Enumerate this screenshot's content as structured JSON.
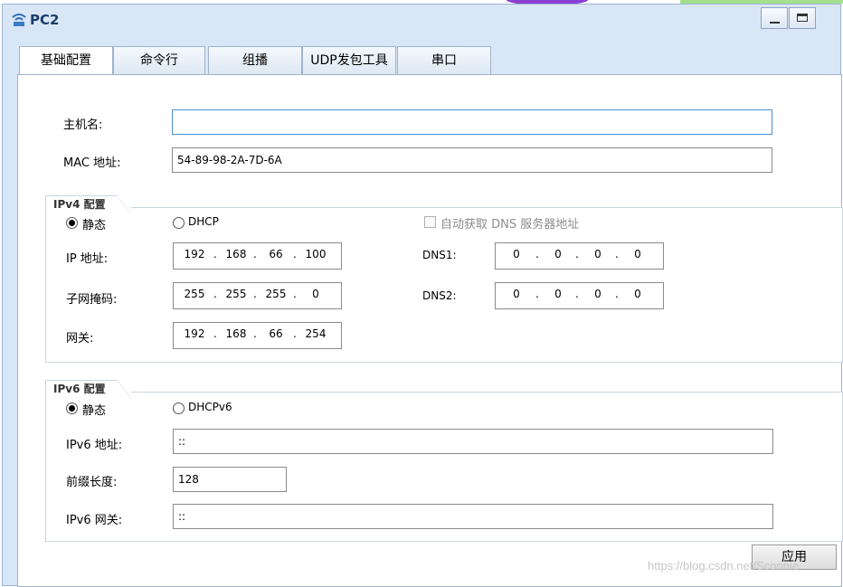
{
  "window": {
    "title": "PC2"
  },
  "tabs": [
    "基础配置",
    "命令行",
    "组播",
    "UDP发包工具",
    "串口"
  ],
  "basic": {
    "hostname_label": "主机名:",
    "hostname_value": "",
    "mac_label": "MAC 地址:",
    "mac_value": "54-89-98-2A-7D-6A"
  },
  "ipv4": {
    "group_title": "IPv4 配置",
    "static_label": "静态",
    "dhcp_label": "DHCP",
    "dns_auto_label": "自动获取 DNS 服务器地址",
    "ip_label": "IP 地址:",
    "ip": [
      "192",
      "168",
      "66",
      "100"
    ],
    "mask_label": "子网掩码:",
    "mask": [
      "255",
      "255",
      "255",
      "0"
    ],
    "gateway_label": "网关:",
    "gateway": [
      "192",
      "168",
      "66",
      "254"
    ],
    "dns1_label": "DNS1:",
    "dns1": [
      "0",
      "0",
      "0",
      "0"
    ],
    "dns2_label": "DNS2:",
    "dns2": [
      "0",
      "0",
      "0",
      "0"
    ]
  },
  "ipv6": {
    "group_title": "IPv6 配置",
    "static_label": "静态",
    "dhcp_label": "DHCPv6",
    "addr_label": "IPv6 地址:",
    "addr_value": "::",
    "prefix_label": "前缀长度:",
    "prefix_value": "128",
    "gateway_label": "IPv6 网关:",
    "gateway_value": "::"
  },
  "apply_label": "应用",
  "watermark": "https://blog.csdn.net/Sconnie"
}
